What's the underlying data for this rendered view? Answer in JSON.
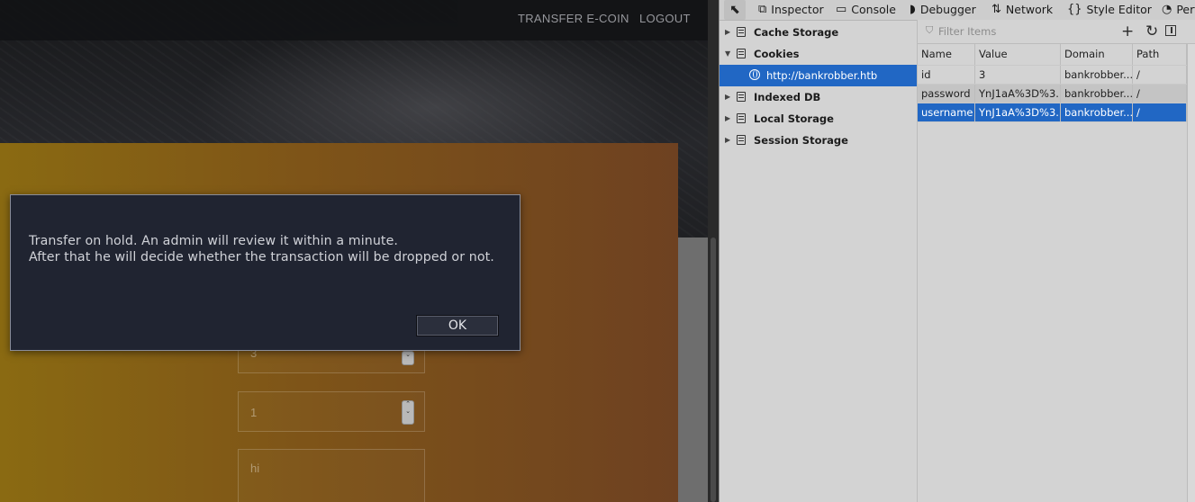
{
  "nav": {
    "transfer": "TRANSFER E-COIN",
    "logout": "LOGOUT"
  },
  "form": {
    "target_value": "3",
    "amount_value": "1",
    "comment_value": "hi"
  },
  "dialog": {
    "line1": "Transfer on hold. An admin will review it within a minute.",
    "line2": "After that he will decide whether the transaction will be dropped or not.",
    "ok": "OK"
  },
  "devtools": {
    "tabs": [
      {
        "label": "Inspector",
        "icon": "inspector-icon"
      },
      {
        "label": "Console",
        "icon": "console-icon"
      },
      {
        "label": "Debugger",
        "icon": "debugger-icon"
      },
      {
        "label": "Network",
        "icon": "network-icon"
      },
      {
        "label": "Style Editor",
        "icon": "style-editor-icon"
      },
      {
        "label": "Perf",
        "icon": "performance-icon"
      }
    ],
    "tree": {
      "cache": "Cache Storage",
      "cookies": "Cookies",
      "site": "http://bankrobber.htb",
      "indexed": "Indexed DB",
      "local": "Local Storage",
      "session": "Session Storage"
    },
    "filter_placeholder": "Filter Items",
    "table": {
      "headers": [
        "Name",
        "Value",
        "Domain",
        "Path"
      ],
      "rows": [
        [
          "id",
          "3",
          "bankrobber....",
          "/"
        ],
        [
          "password",
          "YnJ1aA%3D%3...",
          "bankrobber....",
          "/"
        ],
        [
          "username",
          "YnJ1aA%3D%3...",
          "bankrobber....",
          "/"
        ]
      ]
    },
    "selection_color": "#2167c4"
  }
}
